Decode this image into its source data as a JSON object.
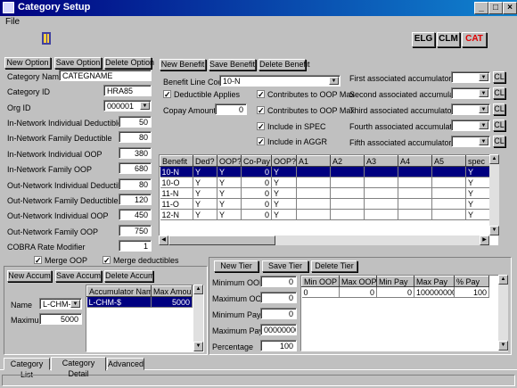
{
  "window": {
    "title": "Category Setup",
    "menu_file": "File"
  },
  "toolbar": {
    "elg": "ELG",
    "clm": "CLM",
    "cat": "CAT"
  },
  "option": {
    "new": "New Option",
    "save": "Save Option",
    "delete": "Delete Option",
    "category_name_label": "Category Name",
    "category_name": "CATEGNAME",
    "category_id_label": "Category ID",
    "category_id": "HRA85",
    "org_id_label": "Org ID",
    "org_id": "000001",
    "fields": [
      {
        "label": "In-Network Individual Deductible",
        "value": "50"
      },
      {
        "label": "In-Network Family Deductible",
        "value": "80"
      },
      {
        "label": "In-Network Individual OOP",
        "value": "380"
      },
      {
        "label": "In-Network Family OOP",
        "value": "680"
      },
      {
        "label": "Out-Network Individual Deductible",
        "value": "80"
      },
      {
        "label": "Out-Network Family Deductible",
        "value": "120"
      },
      {
        "label": "Out-Network Individual OOP",
        "value": "450"
      },
      {
        "label": "Out-Network Family OOP",
        "value": "750"
      },
      {
        "label": "COBRA Rate Modifier",
        "value": "1"
      }
    ],
    "merge_oop": "Merge OOP",
    "merge_deductibles": "Merge deductibles"
  },
  "benefit": {
    "new": "New Benefit",
    "save": "Save Benefit",
    "delete": "Delete Benefit",
    "line_code_label": "Benefit Line Code",
    "line_code": "10-N",
    "deductible_applies": "Deductible Applies",
    "copay_label": "Copay Amount",
    "copay": "0",
    "checks": [
      "Contributes to OOP Max",
      "Contributes to OOP Max",
      "Include in SPEC",
      "Include in AGGR"
    ],
    "accumulators": [
      "First associated accumulator",
      "Second associated accumulator",
      "Third associated accumulator",
      "Fourth associated accumulator",
      "Fifth associated accumulator"
    ],
    "cl": "CL",
    "columns": [
      "Benefit",
      "Ded?",
      "OOP?",
      "Co-Pay",
      "OOP?",
      "A1",
      "A2",
      "A3",
      "A4",
      "A5",
      "spec"
    ],
    "rows": [
      [
        "10-N",
        "Y",
        "Y",
        "0",
        "Y",
        "",
        "",
        "",
        "",
        "",
        "Y"
      ],
      [
        "10-O",
        "Y",
        "Y",
        "0",
        "Y",
        "",
        "",
        "",
        "",
        "",
        "Y"
      ],
      [
        "11-N",
        "Y",
        "Y",
        "0",
        "Y",
        "",
        "",
        "",
        "",
        "",
        "Y"
      ],
      [
        "11-O",
        "Y",
        "Y",
        "0",
        "Y",
        "",
        "",
        "",
        "",
        "",
        "Y"
      ],
      [
        "12-N",
        "Y",
        "Y",
        "0",
        "Y",
        "",
        "",
        "",
        "",
        "",
        "Y"
      ]
    ]
  },
  "accum": {
    "new": "New Accum",
    "save": "Save Accum",
    "delete": "Delete Accum",
    "name_label": "Name",
    "name": "L-CHM-",
    "max_label": "Maximum",
    "max": "5000",
    "columns": [
      "Accumulator Name",
      "Max Amount"
    ],
    "rows": [
      [
        "L-CHM-$",
        "5000"
      ]
    ]
  },
  "tier": {
    "new": "New Tier",
    "save": "Save Tier",
    "delete": "Delete Tier",
    "fields": [
      {
        "label": "Minimum OOP",
        "value": "0"
      },
      {
        "label": "Maximum OOP",
        "value": "0"
      },
      {
        "label": "Minimum Pay",
        "value": "0"
      },
      {
        "label": "Maximum Pay",
        "value": "00000000"
      },
      {
        "label": "Percentage",
        "value": "100"
      }
    ],
    "columns": [
      "Min OOP",
      "Max OOP",
      "Min Pay",
      "Max Pay",
      "% Pay"
    ],
    "rows": [
      [
        "0",
        "0",
        "0",
        "100000000",
        "100"
      ]
    ]
  },
  "tabs": [
    "Category List",
    "Category Detail",
    "Advanced"
  ]
}
